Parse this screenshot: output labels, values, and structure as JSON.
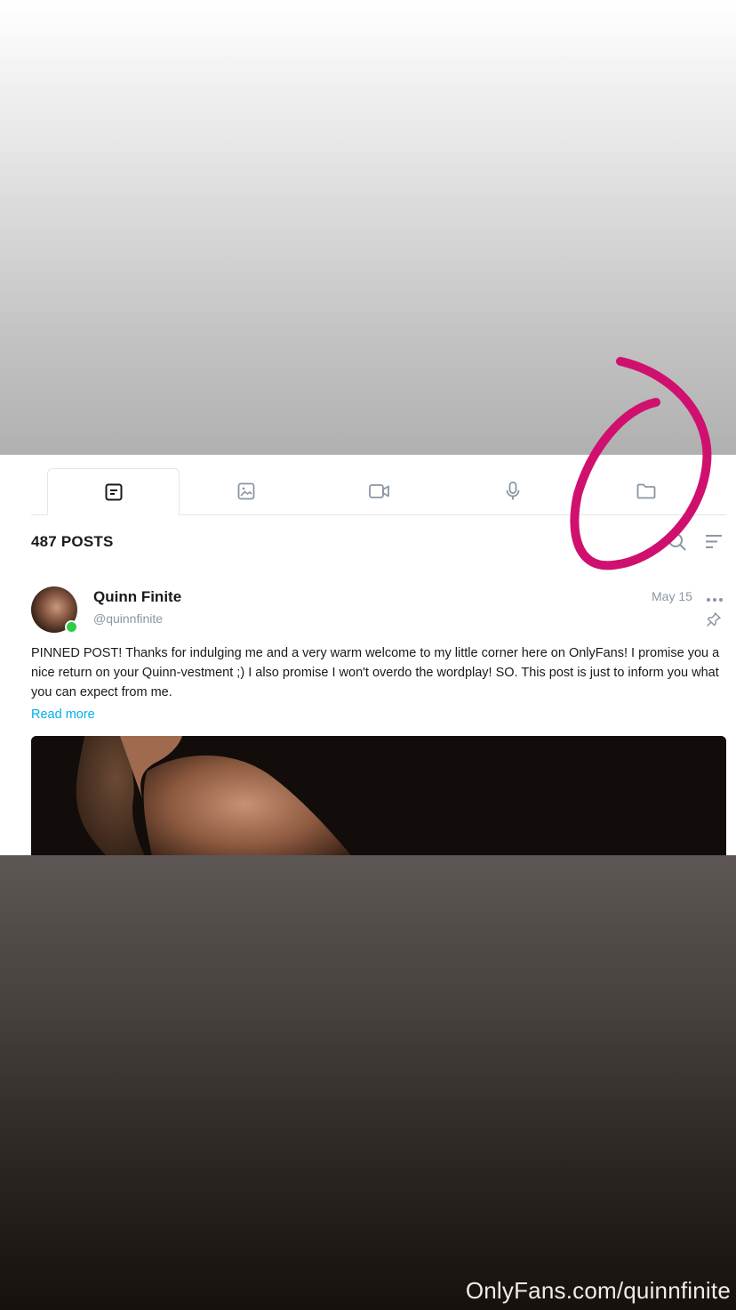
{
  "tabs": [
    {
      "icon": "posts-icon",
      "active": true
    },
    {
      "icon": "photo-icon",
      "active": false
    },
    {
      "icon": "video-icon",
      "active": false
    },
    {
      "icon": "microphone-icon",
      "active": false
    },
    {
      "icon": "folder-icon",
      "active": false
    }
  ],
  "feed": {
    "posts_count": "487 POSTS"
  },
  "post": {
    "author_name": "Quinn Finite",
    "author_handle": "@quinnfinite",
    "date": "May 15",
    "text": "PINNED POST! Thanks for indulging me and a very warm welcome to my little corner here on OnlyFans! I promise you a nice return on your Quinn-vestment ;) I also promise I won't overdo the wordplay! SO. This post is just to inform you what you can expect from me.",
    "read_more": "Read more"
  },
  "watermark": "OnlyFans.com/quinnfinite",
  "colors": {
    "accent": "#00aff0",
    "online": "#2ecc40",
    "annotation": "#d0106e",
    "muted": "#8a96a3"
  }
}
